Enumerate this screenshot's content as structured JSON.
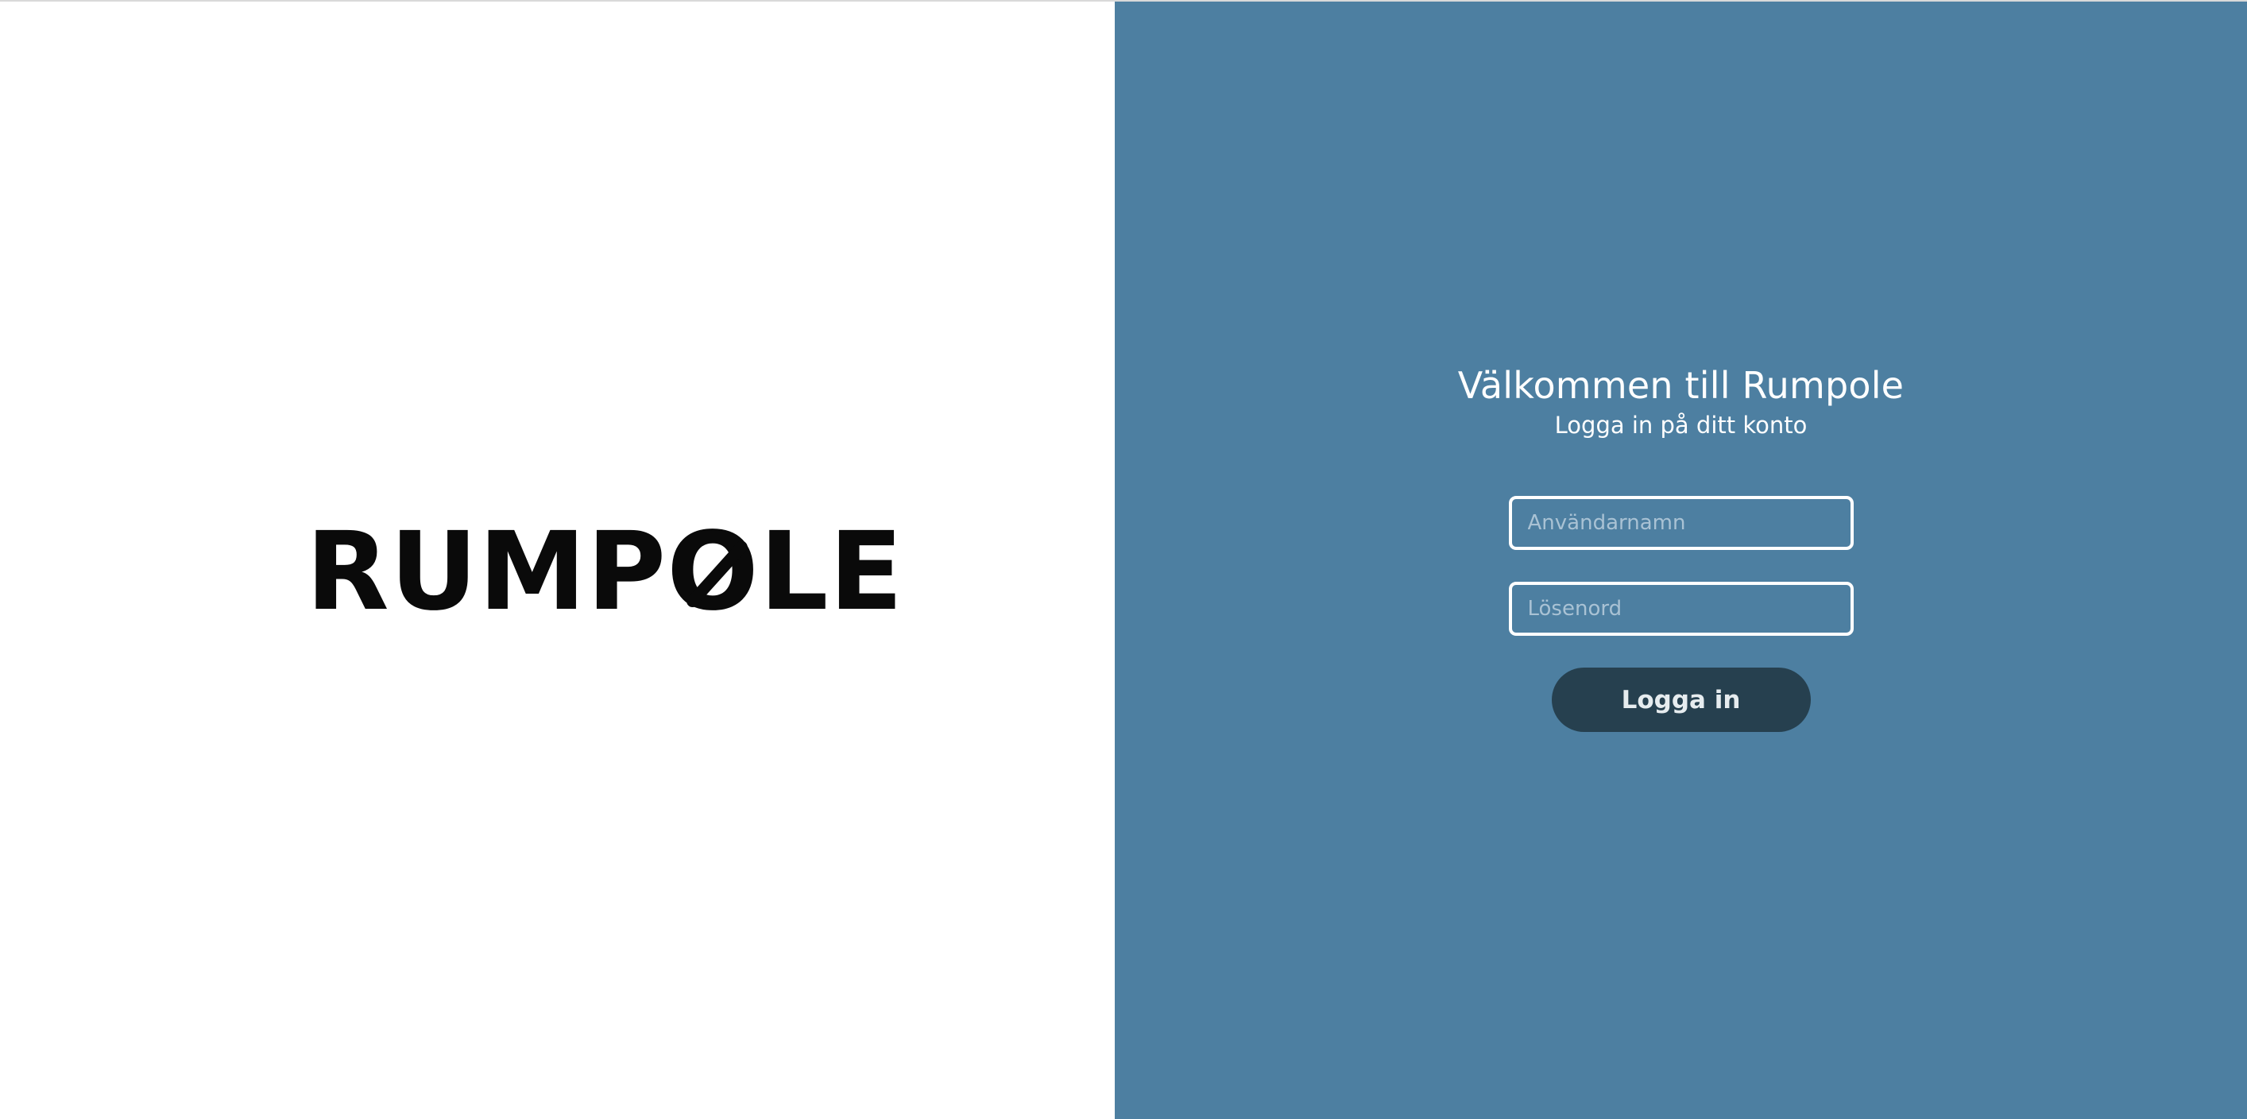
{
  "brand": {
    "logo_text": "RUMPOLE"
  },
  "login": {
    "title": "Välkommen till Rumpole",
    "subtitle": "Logga in på ditt konto",
    "username_placeholder": "Användarnamn",
    "username_value": "",
    "password_placeholder": "Lösenord",
    "password_value": "",
    "submit_label": "Logga in"
  },
  "colors": {
    "left_background": "#ffffff",
    "right_background": "#4d7fa1",
    "button_background": "#26404f",
    "logo": "#0a0a0a"
  }
}
